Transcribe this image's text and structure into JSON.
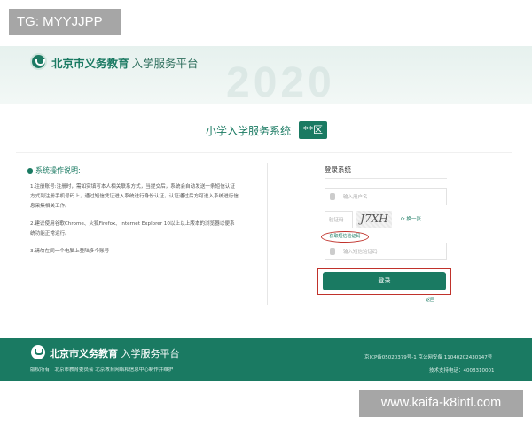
{
  "watermarks": {
    "top": "TG: MYYJJPP",
    "bottom": "www.kaifa-k8intl.com"
  },
  "header": {
    "title_bold": "北京市义务教育",
    "title_plain": "入学服务平台",
    "deco": "2020"
  },
  "system": {
    "title": "小学入学服务系统",
    "badge": "**区"
  },
  "instructions": {
    "heading": "系统操作说明:",
    "p1": "1.注册账号:注册时，需如实填写本人相关联系方式，当提交后，系统会自动发送一条短信认证方式到注册手机号码上，通过短信凭证进入系统进行身份认证，认证通过后方可进入系统进行信息采集相关工作。",
    "p2": "2.建议使用谷歌Chrome、火狐Firefox、Internet Explorer 10以上以上版本的浏览器以便系统功能正常运行。",
    "p3": "3.请勿在同一个电脑上登陆多个账号"
  },
  "login": {
    "title": "登录系统",
    "username_placeholder": "输入用户名",
    "captcha_placeholder": "验证码",
    "captcha_text": "J7XH",
    "refresh": "换一张",
    "sms_link": "获取短信验证码",
    "sms_placeholder": "输入短信验证码",
    "button": "登录",
    "small_link": "返回"
  },
  "footer": {
    "title_bold": "北京市义务教育",
    "title_plain": "入学服务平台",
    "copyright": "版权所有：北京市教育委员会 北京教育网络和信息中心制作并维护",
    "icp": "京ICP备05020379号-1 京公网安备 11040202430147号",
    "tel": "技术支持电话：4008310001"
  },
  "colors": {
    "brand": "#1a7a62",
    "highlight": "#c0322b"
  }
}
